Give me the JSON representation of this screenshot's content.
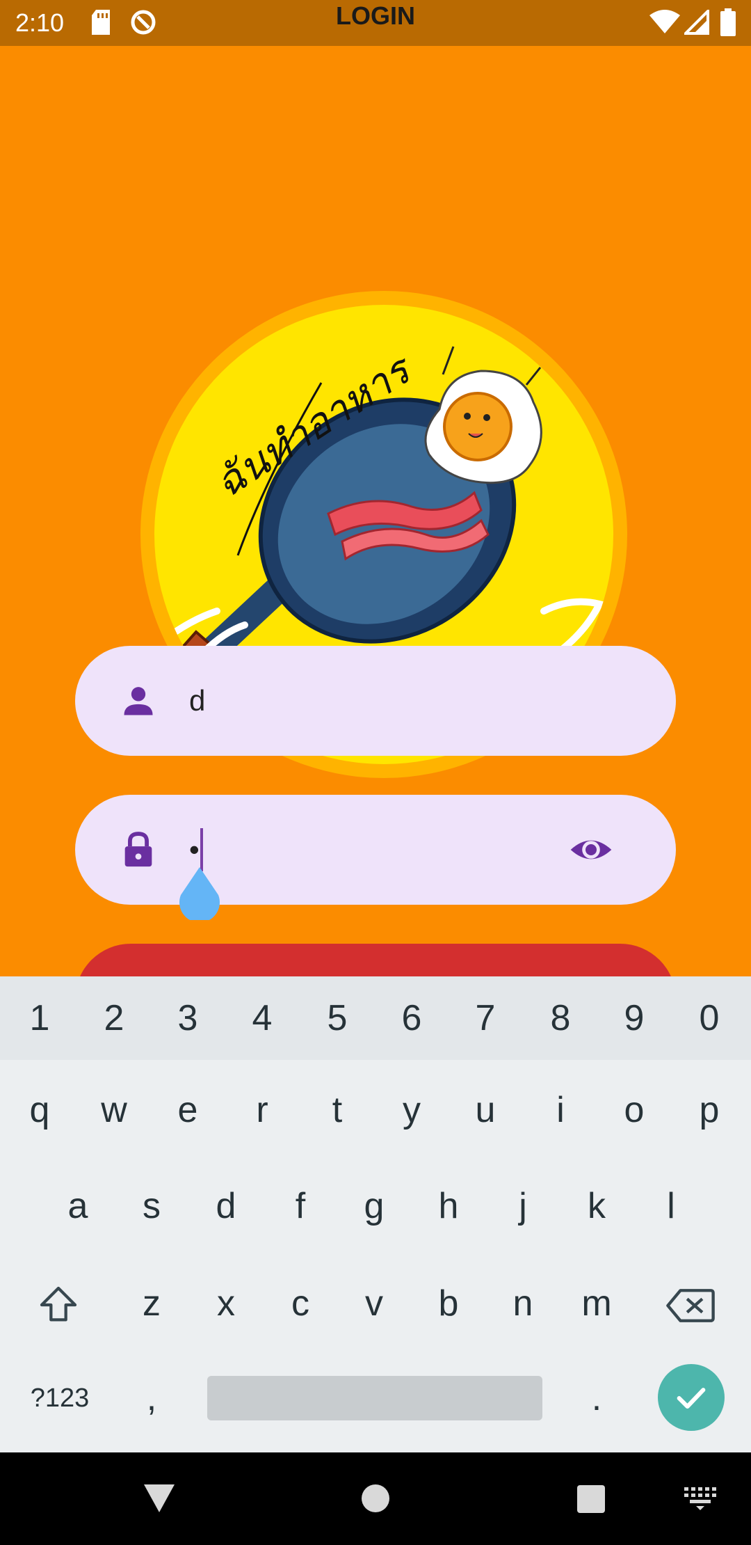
{
  "status_bar": {
    "time": "2:10",
    "title": "LOGIN"
  },
  "logo": {
    "caption": "ฉันทำอาหาร"
  },
  "form": {
    "username_value": "d",
    "password_value": "•",
    "username_icon": "person-icon",
    "password_icon": "lock-icon",
    "visibility_icon": "eye-icon"
  },
  "keyboard": {
    "number_row": [
      "1",
      "2",
      "3",
      "4",
      "5",
      "6",
      "7",
      "8",
      "9",
      "0"
    ],
    "row1": [
      "q",
      "w",
      "e",
      "r",
      "t",
      "y",
      "u",
      "i",
      "o",
      "p"
    ],
    "row2": [
      "a",
      "s",
      "d",
      "f",
      "g",
      "h",
      "j",
      "k",
      "l"
    ],
    "row3": [
      "z",
      "x",
      "c",
      "v",
      "b",
      "n",
      "m"
    ],
    "symbols_label": "?123",
    "comma": ",",
    "period": "."
  },
  "colors": {
    "background": "#FB8C00",
    "status_bar": "#B96A02",
    "field": "#EFE3FA",
    "icon_purple": "#6A2FA0",
    "button_red": "#D32F2F",
    "enter_teal": "#4DB6AC"
  }
}
